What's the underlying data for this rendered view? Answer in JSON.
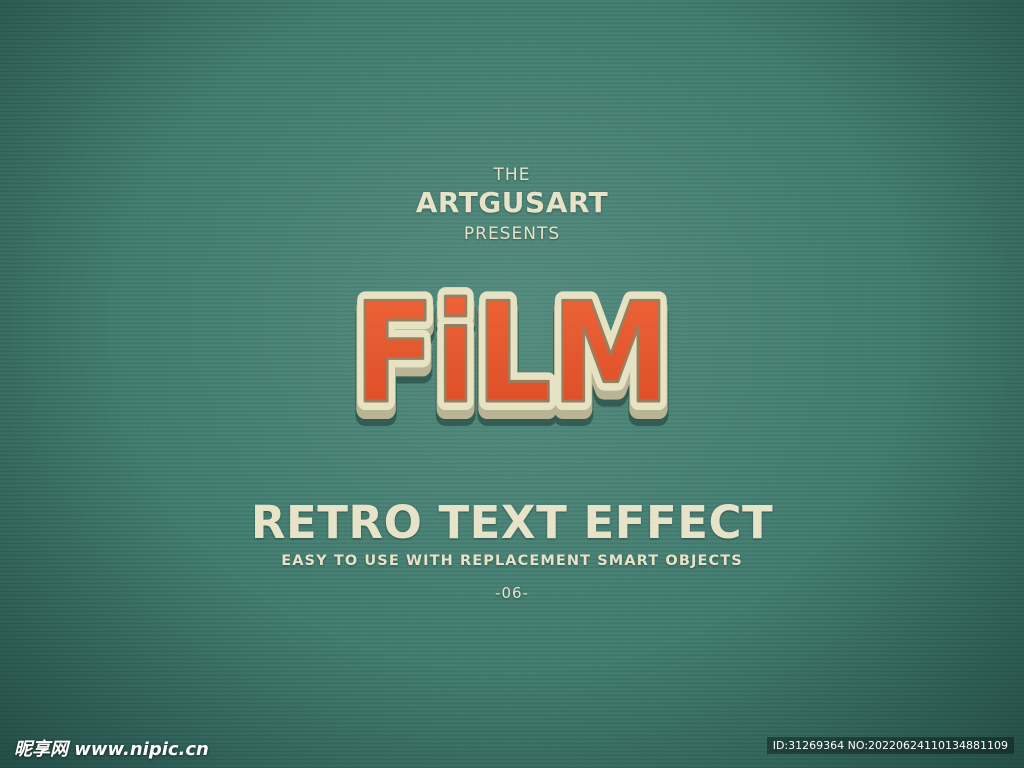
{
  "header": {
    "the": "THE",
    "brand": "ARTGUSART",
    "presents": "PRESENTS"
  },
  "logo": {
    "word": "FiLM",
    "fill_color": "#e8582f",
    "outline_color": "#e6e2c4",
    "depth_color": "#b8b494"
  },
  "footer": {
    "headline": "RETRO TEXT EFFECT",
    "subline": "EASY TO USE WITH REPLACEMENT SMART OBJECTS",
    "number": "-06-"
  },
  "watermark": {
    "site": "昵享网 www.nipic.cn",
    "id": "ID:31269364 NO:20220624110134881109"
  },
  "colors": {
    "background": "#3f7a6e",
    "text": "#e7e3c8"
  }
}
